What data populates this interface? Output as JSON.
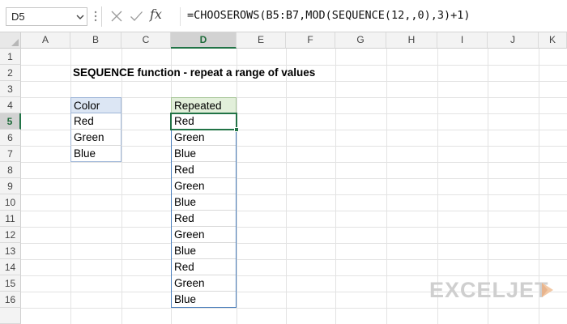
{
  "formula_bar": {
    "name_box": "D5",
    "fx_label": "fx",
    "formula": "=CHOOSEROWS(B5:B7,MOD(SEQUENCE(12,,0),3)+1)"
  },
  "columns": [
    "A",
    "B",
    "C",
    "D",
    "E",
    "F",
    "G",
    "H",
    "I",
    "J",
    "K"
  ],
  "active_column": "D",
  "rows": [
    "1",
    "2",
    "3",
    "4",
    "5",
    "6",
    "7",
    "8",
    "9",
    "10",
    "11",
    "12",
    "13",
    "14",
    "15",
    "16"
  ],
  "active_row": "5",
  "sheet": {
    "title": "SEQUENCE function - repeat a range of values",
    "source_header": "Color",
    "source_values": [
      "Red",
      "Green",
      "Blue"
    ],
    "result_header": "Repeated",
    "result_values": [
      "Red",
      "Green",
      "Blue",
      "Red",
      "Green",
      "Blue",
      "Red",
      "Green",
      "Blue",
      "Red",
      "Green",
      "Blue"
    ]
  },
  "logo": {
    "text": "EXCELJET",
    "color": "#cfcfcf",
    "accent": "#f2c9a6"
  },
  "colors": {
    "excel_green": "#217346",
    "table_blue": "#dce6f4",
    "table_green": "#e2efda"
  }
}
